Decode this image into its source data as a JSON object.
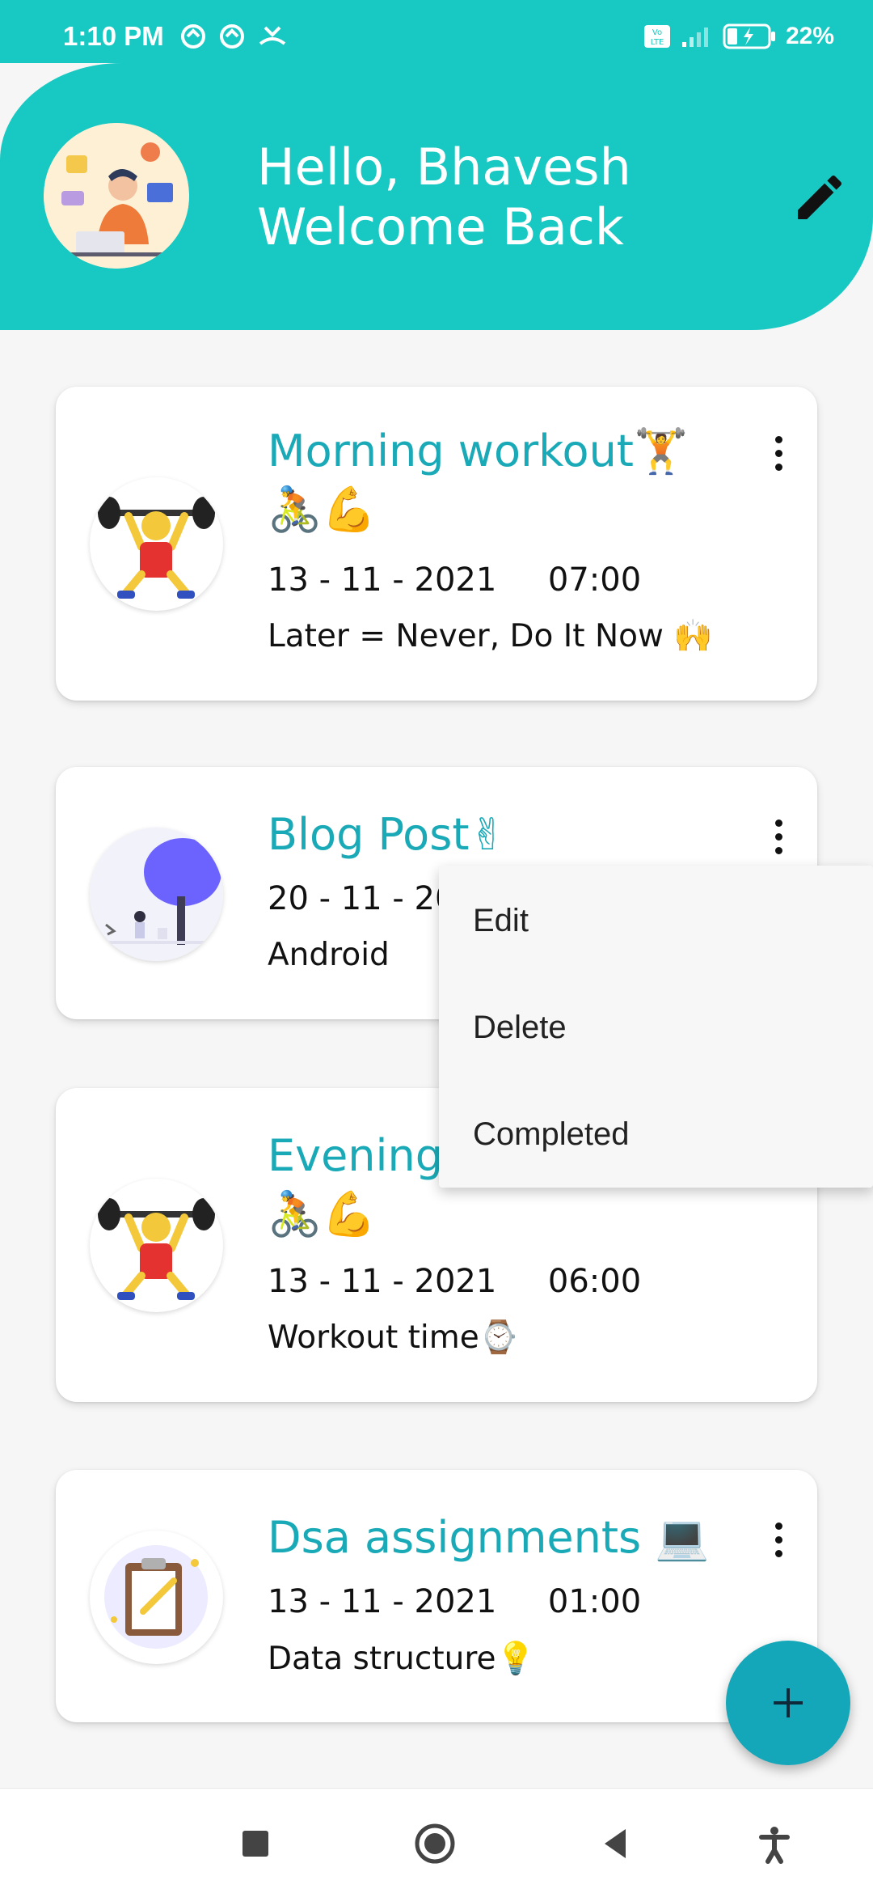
{
  "status_bar": {
    "time": "1:10 PM",
    "battery": "22%",
    "icons_left": [
      "data-saver-icon",
      "data-saver-icon",
      "missed-call-icon"
    ],
    "icons_right": [
      "volte-icon",
      "signal-icon",
      "battery-charging-icon"
    ]
  },
  "header": {
    "greeting_line1": "Hello, Bhavesh",
    "greeting_line2": "Welcome Back",
    "accent_color": "#17c9c2"
  },
  "tasks": [
    {
      "title": "Morning workout🏋🚴💪",
      "date": "13 - 11 - 2021",
      "time": "07:00",
      "note": "Later = Never, Do It Now 🙌",
      "image": "weightlifter-illustration"
    },
    {
      "title": "Blog Post✌",
      "date": "20 - 11 - 202",
      "time": "",
      "note": "Android",
      "image": "tree-reading-illustration"
    },
    {
      "title": "Evening",
      "title_line2": "🚴💪",
      "date": "13 - 11 - 2021",
      "time": "06:00",
      "note": "Workout time⌚",
      "image": "weightlifter-illustration"
    },
    {
      "title": "Dsa assignments 💻",
      "date": "13 - 11 - 2021",
      "time": "01:00",
      "note": "Data structure💡",
      "image": "clipboard-illustration"
    }
  ],
  "context_menu": {
    "items": [
      "Edit",
      "Delete",
      "Completed"
    ]
  },
  "fab": {
    "label": "+"
  },
  "nav_bar": [
    "recents-button",
    "home-button",
    "back-button",
    "accessibility-button"
  ]
}
